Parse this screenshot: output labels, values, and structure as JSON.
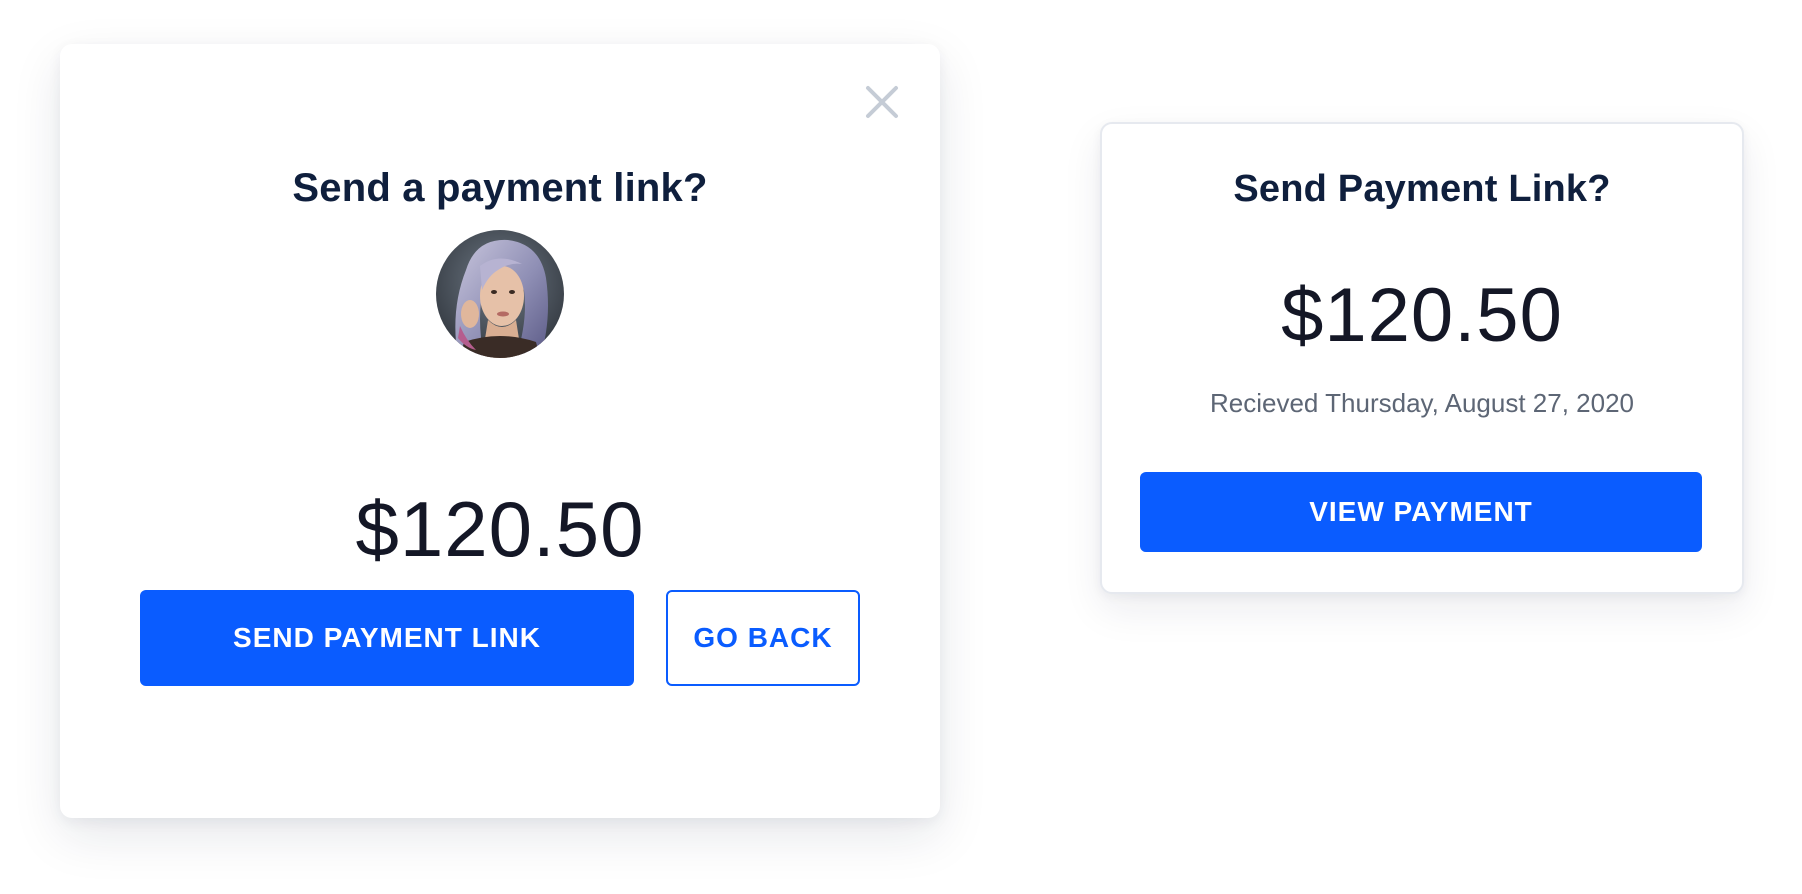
{
  "modal": {
    "title": "Send a payment link?",
    "amount": "$120.50",
    "close_icon": "close-icon",
    "primary_button": "SEND PAYMENT LINK",
    "secondary_button": "GO BACK"
  },
  "card": {
    "title": "Send Payment Link?",
    "amount": "$120.50",
    "date": "Recieved Thursday, August 27, 2020",
    "button": "VIEW PAYMENT"
  },
  "colors": {
    "accent": "#0a5cff",
    "heading": "#0f1f3d",
    "amount": "#141726",
    "muted": "#5d6675",
    "close_icon": "#c5ccd6"
  }
}
